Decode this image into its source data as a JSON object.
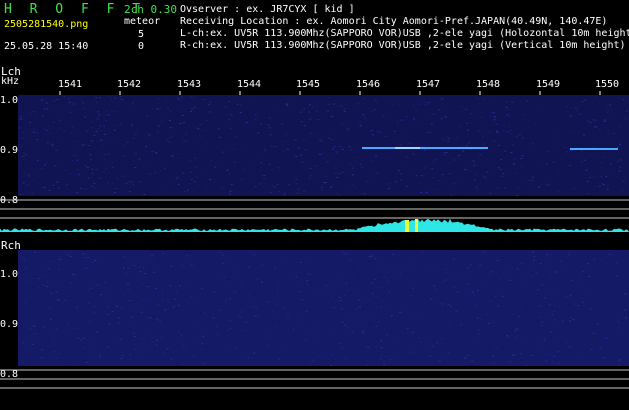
{
  "header": {
    "logo": "H R O F F T",
    "version": "2ch 0.30",
    "filename": "2505281540.png",
    "meteor_label": "meteor",
    "lch_count": "5",
    "rch_count": "0",
    "timestamp": "25.05.28 15:40",
    "observer": "Ovserver           : ex. JR7CYX [ kid ]",
    "location": "Receiving Location : ex. Aomori City Aomori-Pref.JAPAN(40.49N, 140.47E)",
    "lch_info": "L-ch:ex. UV5R 113.900Mhz(SAPPORO VOR)USB ,2-ele yagi (Holozontal 10m height)",
    "rch_info": "R-ch:ex. UV5R 113.900Mhz(SAPPORO VOR)USB ,2-ele yagi (Vertical 10m height)"
  },
  "lch": {
    "label": "Lch",
    "unit": "kHz",
    "freq_ticks": [
      "1541",
      "1542",
      "1543",
      "1544",
      "1545",
      "1546",
      "1547",
      "1548",
      "1549",
      "1550"
    ],
    "y_ticks": [
      "1.0",
      "0.9",
      "0.8"
    ]
  },
  "rch": {
    "label": "Rch",
    "y_ticks": [
      "1.0",
      "0.9",
      "0.8"
    ]
  },
  "colors": {
    "background": "#000000",
    "waterfall": "#141860",
    "spectrum": "#2ee6e6",
    "logo": "#3ee24a",
    "filename": "#ffff00",
    "signal": "#4aa8ff"
  }
}
